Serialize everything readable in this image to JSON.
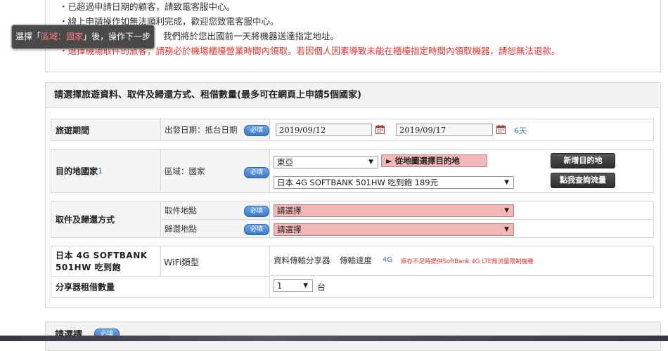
{
  "notices": [
    "・已超過申請日期的顧客，請致電客服中心。",
    "・線上申請操作如無法順利完成，歡迎您致電客服中心。",
    "我們將於您出國前一天將機器送達指定地址。",
    "・選擇機場取件的旅客，請務必於機場櫃檯營業時間內領取。若因個人因素導致未能在櫃檯指定時間內領取機器，請恕無法退款。"
  ],
  "tooltip": {
    "prefix": "選擇「",
    "highlight": "區域：國家",
    "suffix": "」後，操作下一步"
  },
  "section_title": "請選擇旅遊資料、取件及歸還方式、租借數量(最多可在網頁上申請5個國家)",
  "required_label": "必填",
  "travel": {
    "label": "旅遊期間",
    "sub": "出發日期：抵台日期",
    "start_date": "2019/09/12",
    "end_date": "2019/09/17",
    "days": "6天"
  },
  "destination": {
    "label": "目的地國家",
    "index": "1",
    "sub": "區域：國家",
    "region": "東亞",
    "map_button": "► 從地圖選擇目的地",
    "product": "日本 4G SOFTBANK 501HW 吃到飽 189元",
    "add_button": "新增目的地",
    "check_button": "點我查詢流量"
  },
  "pickup": {
    "label": "取件及歸還方式",
    "pickup_sub": "取件地點",
    "return_sub": "歸還地點",
    "pickup_value": "請選擇",
    "return_value": "請選擇"
  },
  "device": {
    "name_line1": "日本 4G SOFTBANK",
    "name_line2": "501HW 吃到飽",
    "type_label": "WiFi類型",
    "type_value": "資料傳輸分享器",
    "speed_label": "傳輸速度",
    "speed_value": "4G",
    "note": "庫存不足時提供SoftBank 4G LTE無流量限制機種"
  },
  "quantity": {
    "label": "分享器租借數量",
    "value": "1",
    "unit": "台"
  },
  "bottom_title": "請選擇",
  "colors": {
    "red": "#e8322e",
    "pink": "#f4b7b7",
    "badge_blue": "#3a78c9"
  }
}
